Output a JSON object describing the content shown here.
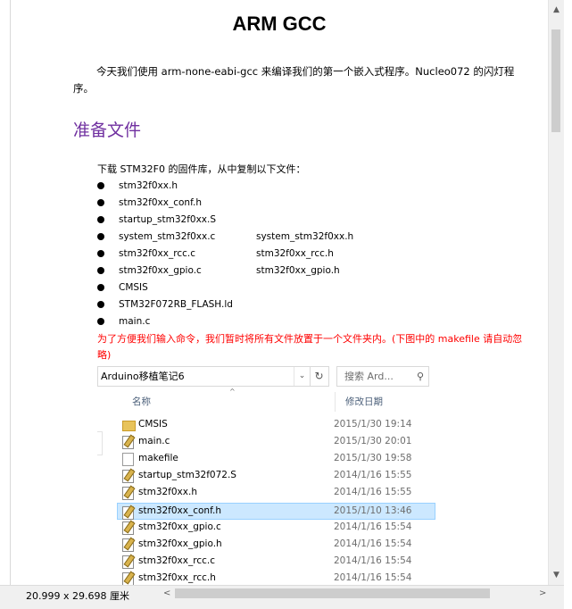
{
  "document": {
    "title": "ARM GCC",
    "intro": "今天我们使用 arm-none-eabi-gcc 来编译我们的第一个嵌入式程序。Nucleo072 的闪灯程序。",
    "section_heading": "准备文件",
    "download_text": "下载 STM32F0 的固件库，从中复制以下文件：",
    "files": [
      {
        "a": "stm32f0xx.h",
        "b": ""
      },
      {
        "a": "stm32f0xx_conf.h",
        "b": ""
      },
      {
        "a": "startup_stm32f0xx.S",
        "b": ""
      },
      {
        "a": "system_stm32f0xx.c",
        "b": "system_stm32f0xx.h"
      },
      {
        "a": "stm32f0xx_rcc.c",
        "b": "stm32f0xx_rcc.h"
      },
      {
        "a": "stm32f0xx_gpio.c",
        "b": "stm32f0xx_gpio.h"
      },
      {
        "a": "CMSIS",
        "b": ""
      },
      {
        "a": "STM32F072RB_FLASH.ld",
        "b": ""
      },
      {
        "a": "main.c",
        "b": ""
      }
    ],
    "note": "为了方便我们输入命令，我们暂时将所有文件放置于一个文件夹内。(下图中的 makefile 请自动忽略)"
  },
  "explorer": {
    "address": "Arduino移植笔记6",
    "search_placeholder": "搜索 Ard...",
    "col_name": "名称",
    "col_date": "修改日期",
    "rows": [
      {
        "name": "CMSIS",
        "date": "2015/1/30 19:14",
        "icon": "folder-icon"
      },
      {
        "name": "main.c",
        "date": "2015/1/30 20:01",
        "icon": "edit-file-icon"
      },
      {
        "name": "makefile",
        "date": "2015/1/30 19:58",
        "icon": "file-icon"
      },
      {
        "name": "startup_stm32f072.S",
        "date": "2014/1/16 15:55",
        "icon": "edit-file-icon"
      },
      {
        "name": "stm32f0xx.h",
        "date": "2014/1/16 15:55",
        "icon": "edit-file-icon"
      },
      {
        "name": "stm32f0xx_conf.h",
        "date": "2015/1/10 13:46",
        "icon": "edit-file-icon"
      },
      {
        "name": "stm32f0xx_gpio.c",
        "date": "2014/1/16 15:54",
        "icon": "edit-file-icon"
      },
      {
        "name": "stm32f0xx_gpio.h",
        "date": "2014/1/16 15:54",
        "icon": "edit-file-icon"
      },
      {
        "name": "stm32f0xx_rcc.c",
        "date": "2014/1/16 15:54",
        "icon": "edit-file-icon"
      },
      {
        "name": "stm32f0xx_rcc.h",
        "date": "2014/1/16 15:54",
        "icon": "edit-file-icon"
      }
    ],
    "selected_row": "stm32f0xx_conf.h"
  },
  "status": {
    "page_size": "20.999 x 29.698 厘米"
  },
  "colors": {
    "heading": "#7030a0",
    "note": "#ff0000",
    "selection": "#cce8ff"
  }
}
